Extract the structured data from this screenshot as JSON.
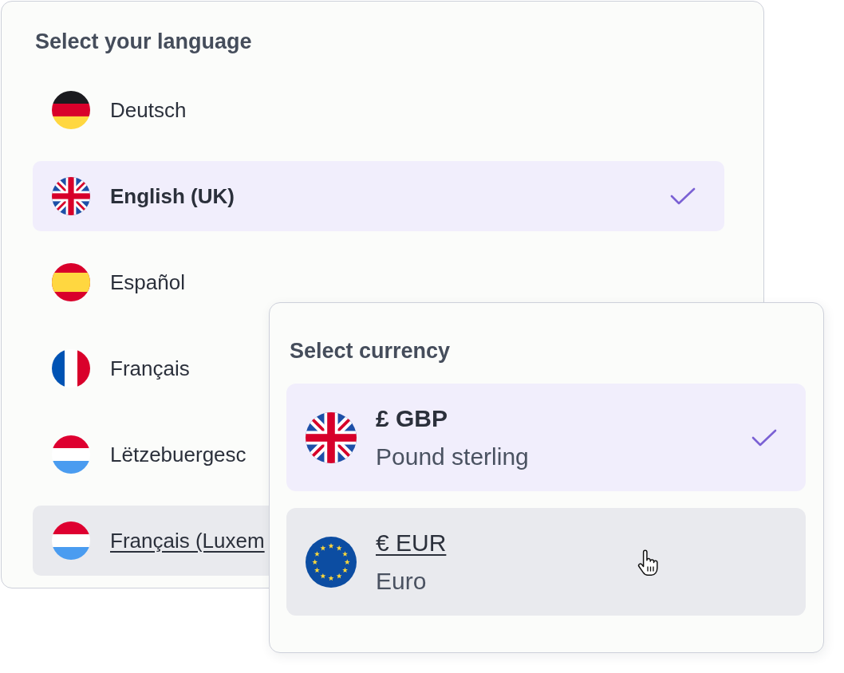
{
  "language_panel": {
    "title": "Select your language",
    "items": [
      {
        "label": "Deutsch",
        "kind": "germany",
        "selected": false,
        "hovered": false
      },
      {
        "label": "English (UK)",
        "kind": "uk",
        "selected": true,
        "hovered": false
      },
      {
        "label": "Español",
        "kind": "spain",
        "selected": false,
        "hovered": false
      },
      {
        "label": "Français",
        "kind": "france",
        "selected": false,
        "hovered": false
      },
      {
        "label": "Lëtzebuergesc",
        "kind": "luxembourg",
        "selected": false,
        "hovered": false
      },
      {
        "label": "Français (Luxem",
        "kind": "luxembourg",
        "selected": false,
        "hovered": true
      }
    ]
  },
  "currency_panel": {
    "title": "Select currency",
    "items": [
      {
        "code": "£ GBP",
        "name": "Pound sterling",
        "kind": "uk",
        "selected": true,
        "hovered": false
      },
      {
        "code": "€ EUR",
        "name": "Euro",
        "kind": "eu",
        "selected": false,
        "hovered": true
      }
    ]
  }
}
